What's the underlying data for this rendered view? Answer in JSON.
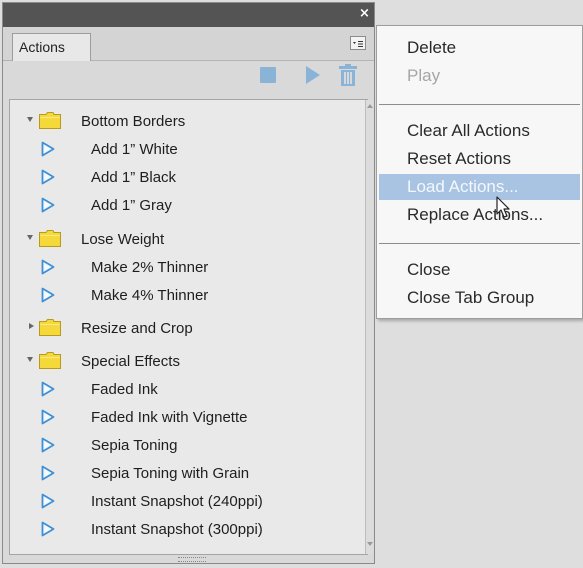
{
  "panel": {
    "tab_label": "Actions",
    "close_glyph": "×",
    "toolbar": {
      "stop_icon": "stop-icon",
      "play_icon": "play-icon",
      "delete_icon": "trash-icon"
    },
    "items": [
      {
        "type": "folder",
        "label": "Bottom Borders",
        "expanded": true
      },
      {
        "type": "action",
        "label": "Add 1” White"
      },
      {
        "type": "action",
        "label": "Add 1” Black"
      },
      {
        "type": "action",
        "label": "Add 1” Gray"
      },
      {
        "type": "folder",
        "label": "Lose Weight",
        "expanded": true
      },
      {
        "type": "action",
        "label": "Make 2% Thinner"
      },
      {
        "type": "action",
        "label": "Make 4% Thinner"
      },
      {
        "type": "folder",
        "label": "Resize and Crop",
        "expanded": false
      },
      {
        "type": "folder",
        "label": "Special Effects",
        "expanded": true
      },
      {
        "type": "action",
        "label": "Faded Ink"
      },
      {
        "type": "action",
        "label": "Faded Ink with Vignette"
      },
      {
        "type": "action",
        "label": "Sepia Toning"
      },
      {
        "type": "action",
        "label": "Sepia Toning with Grain"
      },
      {
        "type": "action",
        "label": "Instant Snapshot (240ppi)"
      },
      {
        "type": "action",
        "label": "Instant Snapshot (300ppi)"
      }
    ]
  },
  "context_menu": {
    "items": [
      {
        "label": "Delete",
        "state": "enabled"
      },
      {
        "label": "Play",
        "state": "disabled"
      },
      {
        "label": "Clear All Actions",
        "state": "enabled"
      },
      {
        "label": "Reset Actions",
        "state": "enabled"
      },
      {
        "label": "Load Actions...",
        "state": "highlighted"
      },
      {
        "label": "Replace Actions...",
        "state": "enabled"
      },
      {
        "label": "Close",
        "state": "enabled"
      },
      {
        "label": "Close Tab Group",
        "state": "enabled"
      }
    ]
  },
  "colors": {
    "accent_blue": "#3d8fd6",
    "folder_yellow": "#f5d83a",
    "highlight": "#a9c3e2",
    "titlebar": "#545454"
  }
}
